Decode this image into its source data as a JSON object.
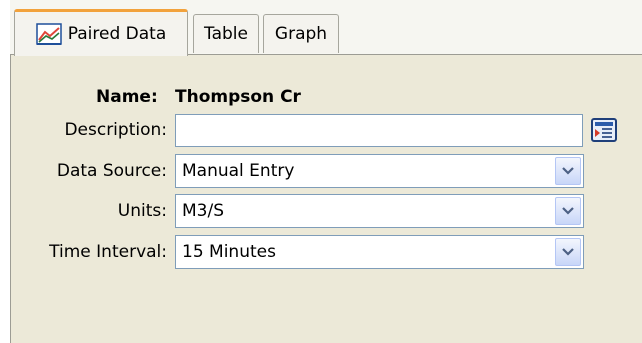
{
  "tabs": [
    {
      "label": "Paired Data",
      "icon": "line-chart-icon",
      "active": true
    },
    {
      "label": "Table",
      "active": false
    },
    {
      "label": "Graph",
      "active": false
    }
  ],
  "form": {
    "name_label": "Name:",
    "name_value": "Thompson Cr",
    "description_label": "Description:",
    "description_value": "",
    "data_source_label": "Data Source:",
    "data_source_value": "Manual Entry",
    "units_label": "Units:",
    "units_value": "M3/S",
    "time_interval_label": "Time Interval:",
    "time_interval_value": "15 Minutes"
  },
  "colors": {
    "panel_bg": "#ece9d8",
    "active_tab_accent": "#f2a23c",
    "field_border": "#7f9db9"
  }
}
